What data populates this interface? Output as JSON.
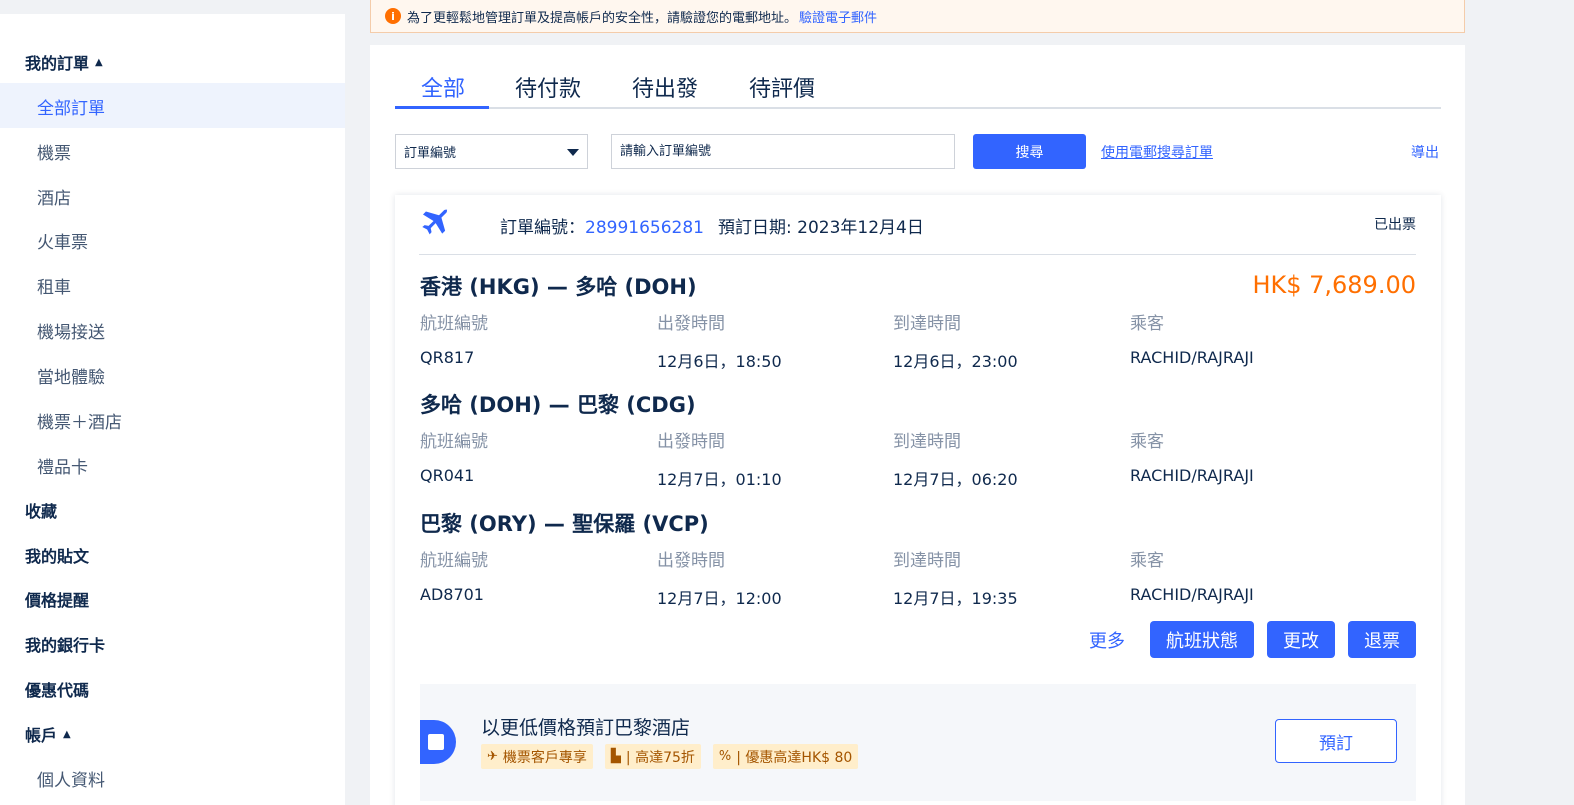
{
  "sidebar": {
    "my_orders": "我的訂單",
    "order_items": [
      "全部訂單",
      "機票",
      "酒店",
      "火車票",
      "租車",
      "機場接送",
      "當地體驗",
      "機票＋酒店",
      "禮品卡"
    ],
    "favorites": "收藏",
    "my_posts": "我的貼文",
    "price_alerts": "價格提醒",
    "bank_cards": "我的銀行卡",
    "promo_codes": "優惠代碼",
    "account": "帳戶",
    "profile": "個人資料"
  },
  "notice": {
    "icon": "info-icon",
    "text": "為了更輕鬆地管理訂單及提高帳戶的安全性，請驗證您的電郵地址。",
    "link": "驗證電子郵件"
  },
  "tabs": [
    "全部",
    "待付款",
    "待出發",
    "待評價"
  ],
  "search": {
    "field_select": "訂單編號",
    "placeholder": "請輸入訂單編號",
    "button": "搜尋",
    "email_link": "使用電郵搜尋訂單",
    "export": "導出"
  },
  "order": {
    "no_label": "訂單編號：",
    "no": "28991656281",
    "date_label": "預訂日期: ",
    "date": "2023年12月4日",
    "status": "已出票",
    "price": "HK$ 7,689.00",
    "col_labels": {
      "flight": "航班編號",
      "depart": "出發時間",
      "arrive": "到達時間",
      "passenger": "乘客"
    },
    "segments": [
      {
        "route": "香港 (HKG) — 多哈 (DOH)",
        "flight": "QR817",
        "depart": "12月6日，18:50",
        "arrive": "12月6日，23:00",
        "passenger": "RACHID/RAJRAJI"
      },
      {
        "route": "多哈 (DOH) — 巴黎 (CDG)",
        "flight": "QR041",
        "depart": "12月7日，01:10",
        "arrive": "12月7日，06:20",
        "passenger": "RACHID/RAJRAJI"
      },
      {
        "route": "巴黎 (ORY) — 聖保羅 (VCP)",
        "flight": "AD8701",
        "depart": "12月7日，12:00",
        "arrive": "12月7日，19:35",
        "passenger": "RACHID/RAJRAJI"
      }
    ],
    "actions": {
      "more": "更多",
      "flight_status": "航班狀態",
      "change": "更改",
      "refund": "退票"
    }
  },
  "promo": {
    "title": "以更低價格預訂巴黎酒店",
    "tags": [
      "機票客戶專享",
      "| 高達75折",
      "| 優惠高達HK$ 80"
    ],
    "button": "預訂"
  },
  "colors": {
    "accent": "#3264ff",
    "price": "#ff6f00",
    "tag_bg": "#ffeecb"
  }
}
